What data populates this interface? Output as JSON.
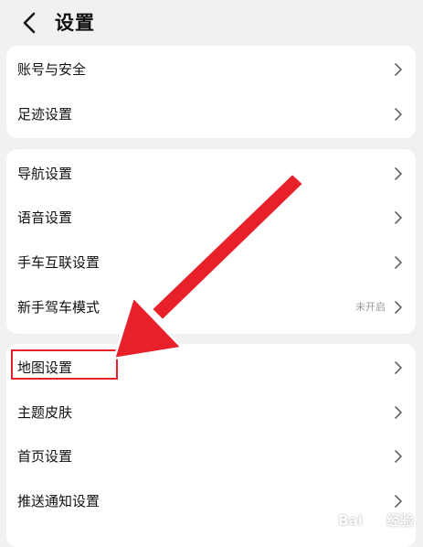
{
  "header": {
    "title": "设置"
  },
  "groups": [
    {
      "items": [
        {
          "label": "账号与安全"
        },
        {
          "label": "足迹设置"
        }
      ]
    },
    {
      "items": [
        {
          "label": "导航设置"
        },
        {
          "label": "语音设置"
        },
        {
          "label": "手车互联设置"
        },
        {
          "label": "新手驾车模式",
          "status": "未开启"
        }
      ]
    },
    {
      "items": [
        {
          "label": "地图设置"
        },
        {
          "label": "主题皮肤"
        },
        {
          "label": "首页设置"
        },
        {
          "label": "推送通知设置"
        }
      ]
    }
  ],
  "annotation": {
    "color": "#e8202a"
  },
  "watermark": {
    "brand_left": "Bai",
    "brand_right": "经验"
  }
}
